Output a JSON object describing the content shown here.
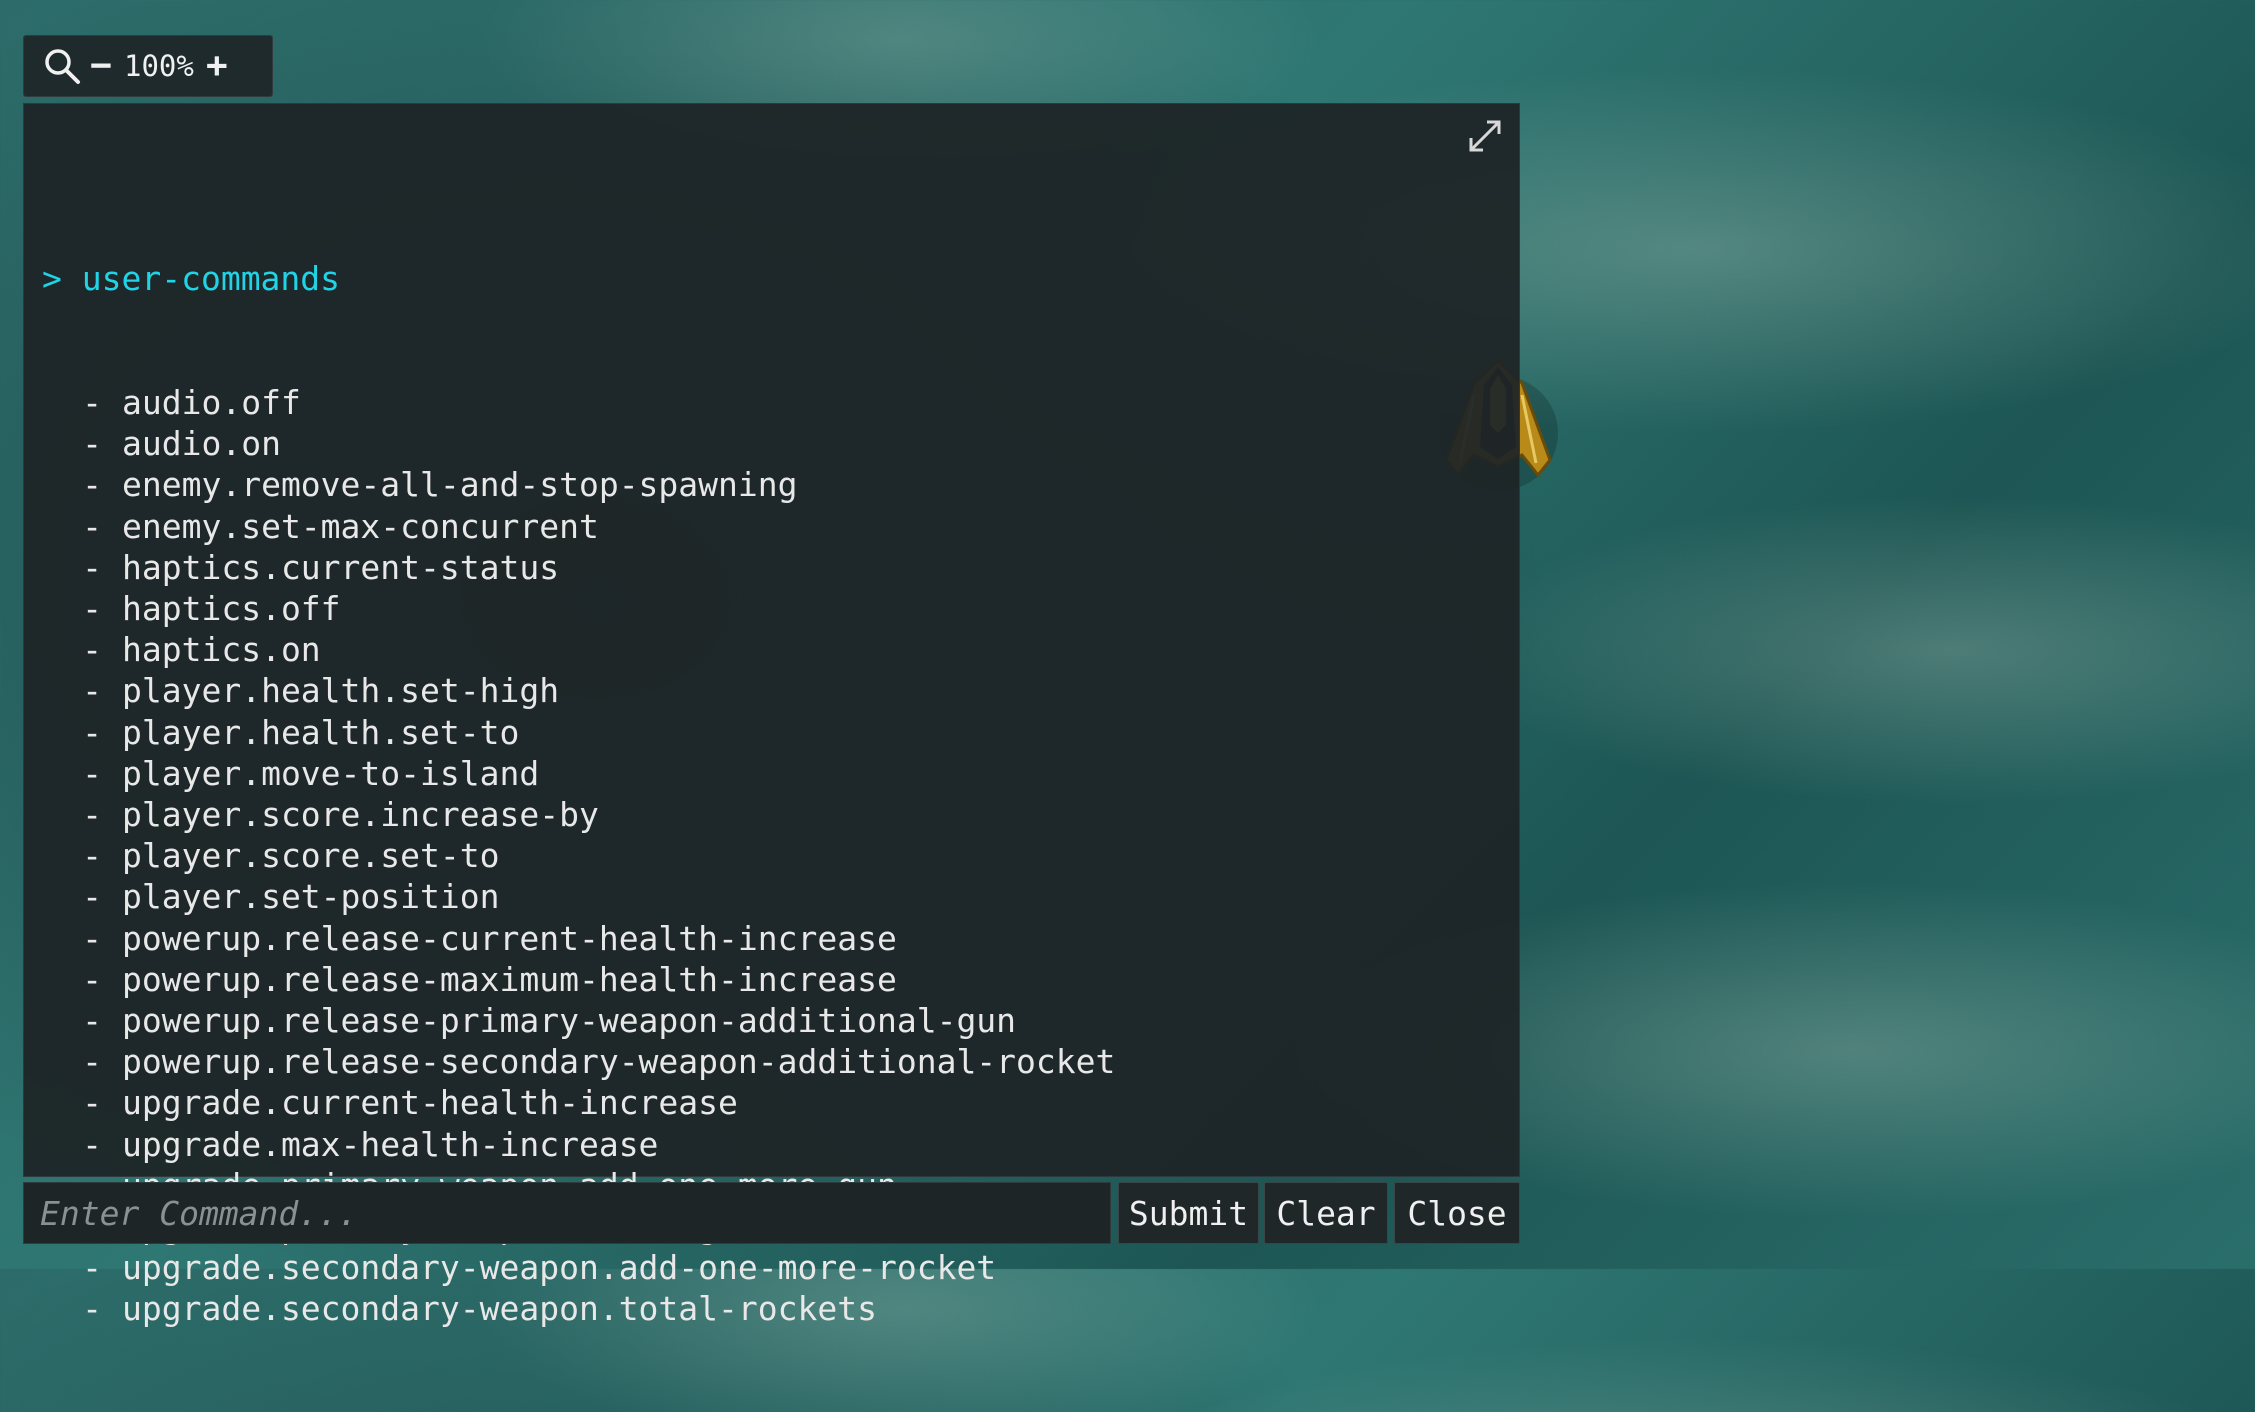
{
  "zoom": {
    "level": "100%",
    "minus": "−",
    "plus": "+"
  },
  "console": {
    "prompt_symbol": ">",
    "command": "user-commands",
    "list_bullet": "-",
    "commands": [
      "audio.off",
      "audio.on",
      "enemy.remove-all-and-stop-spawning",
      "enemy.set-max-concurrent",
      "haptics.current-status",
      "haptics.off",
      "haptics.on",
      "player.health.set-high",
      "player.health.set-to",
      "player.move-to-island",
      "player.score.increase-by",
      "player.score.set-to",
      "player.set-position",
      "powerup.release-current-health-increase",
      "powerup.release-maximum-health-increase",
      "powerup.release-primary-weapon-additional-gun",
      "powerup.release-secondary-weapon-additional-rocket",
      "upgrade.current-health-increase",
      "upgrade.max-health-increase",
      "upgrade.primary-weapon.add-one-more-gun",
      "upgrade.primary-weapon.total-guns",
      "upgrade.secondary-weapon.add-one-more-rocket",
      "upgrade.secondary-weapon.total-rockets"
    ]
  },
  "input": {
    "placeholder": "Enter Command...",
    "value": ""
  },
  "buttons": {
    "submit": "Submit",
    "clear": "Clear",
    "close": "Close"
  },
  "colors": {
    "prompt": "#21d3e6",
    "panel": "#1e2426",
    "ocean": "#2f7773"
  }
}
